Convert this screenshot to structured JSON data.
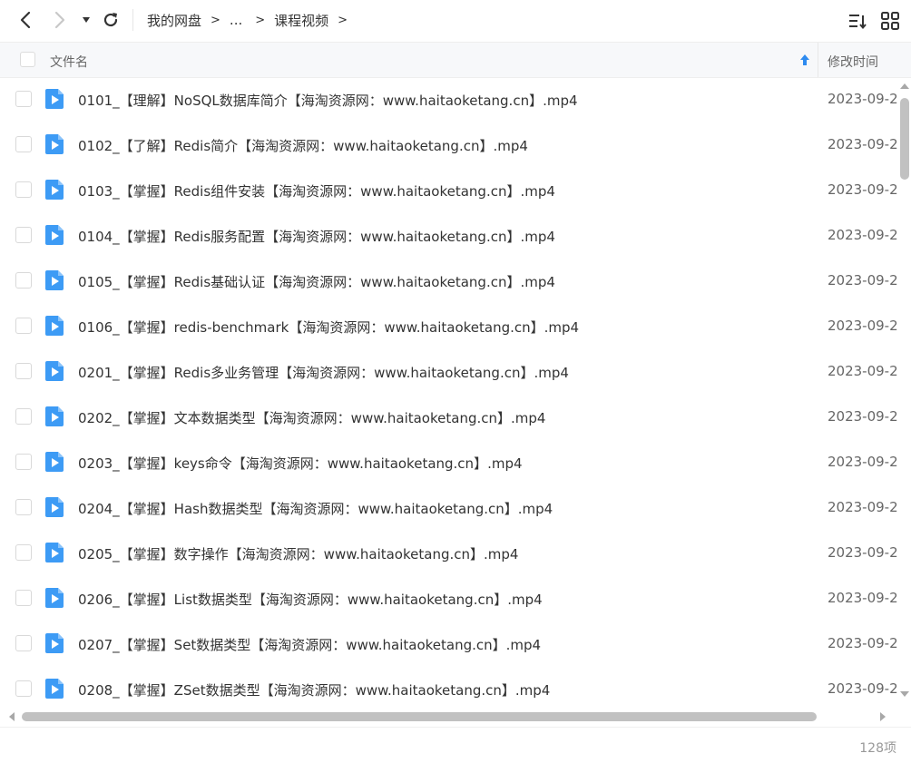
{
  "toolbar": {
    "breadcrumbs": [
      "我的网盘",
      "...",
      "课程视频"
    ],
    "crumb_separator": ">"
  },
  "header": {
    "name_col": "文件名",
    "time_col": "修改时间"
  },
  "files": [
    {
      "name": "0101_【理解】NoSQL数据库简介【海淘资源网：www.haitaoketang.cn】.mp4",
      "time": "2023-09-2"
    },
    {
      "name": "0102_【了解】Redis简介【海淘资源网：www.haitaoketang.cn】.mp4",
      "time": "2023-09-2"
    },
    {
      "name": "0103_【掌握】Redis组件安装【海淘资源网：www.haitaoketang.cn】.mp4",
      "time": "2023-09-2"
    },
    {
      "name": "0104_【掌握】Redis服务配置【海淘资源网：www.haitaoketang.cn】.mp4",
      "time": "2023-09-2"
    },
    {
      "name": "0105_【掌握】Redis基础认证【海淘资源网：www.haitaoketang.cn】.mp4",
      "time": "2023-09-2"
    },
    {
      "name": "0106_【掌握】redis-benchmark【海淘资源网：www.haitaoketang.cn】.mp4",
      "time": "2023-09-2"
    },
    {
      "name": "0201_【掌握】Redis多业务管理【海淘资源网：www.haitaoketang.cn】.mp4",
      "time": "2023-09-2"
    },
    {
      "name": "0202_【掌握】文本数据类型【海淘资源网：www.haitaoketang.cn】.mp4",
      "time": "2023-09-2"
    },
    {
      "name": "0203_【掌握】keys命令【海淘资源网：www.haitaoketang.cn】.mp4",
      "time": "2023-09-2"
    },
    {
      "name": "0204_【掌握】Hash数据类型【海淘资源网：www.haitaoketang.cn】.mp4",
      "time": "2023-09-2"
    },
    {
      "name": "0205_【掌握】数字操作【海淘资源网：www.haitaoketang.cn】.mp4",
      "time": "2023-09-2"
    },
    {
      "name": "0206_【掌握】List数据类型【海淘资源网：www.haitaoketang.cn】.mp4",
      "time": "2023-09-2"
    },
    {
      "name": "0207_【掌握】Set数据类型【海淘资源网：www.haitaoketang.cn】.mp4",
      "time": "2023-09-2"
    },
    {
      "name": "0208_【掌握】ZSet数据类型【海淘资源网：www.haitaoketang.cn】.mp4",
      "time": "2023-09-2"
    }
  ],
  "footer": {
    "count": "128项"
  },
  "colors": {
    "accent": "#2e8bf0",
    "icon_blue": "#3d9bf5"
  },
  "icons": [
    "back-icon",
    "forward-icon",
    "dropdown-icon",
    "refresh-icon",
    "sort-list-icon",
    "grid-view-icon",
    "sort-ascending-icon",
    "video-file-icon"
  ]
}
